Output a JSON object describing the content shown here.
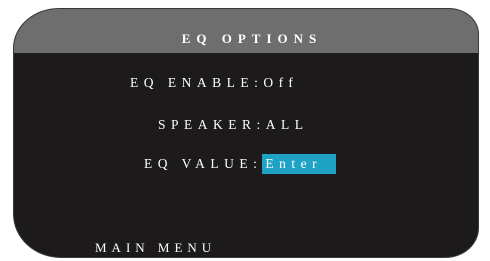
{
  "header": {
    "title": "EQ OPTIONS"
  },
  "menu": {
    "rows": [
      {
        "label": "EQ ENABLE",
        "separator": ":",
        "value": "Off",
        "selected": false
      },
      {
        "label": "SPEAKER",
        "separator": ":",
        "value": "ALL",
        "selected": false
      },
      {
        "label": "EQ VALUE",
        "separator": ":",
        "value": "Enter",
        "selected": true
      }
    ]
  },
  "footer": {
    "label": "MAIN MENU"
  },
  "colors": {
    "background": "#1c1a1b",
    "header_bar": "#6e6e6e",
    "text": "#ffffff",
    "selection_highlight": "#1ea3c4"
  }
}
